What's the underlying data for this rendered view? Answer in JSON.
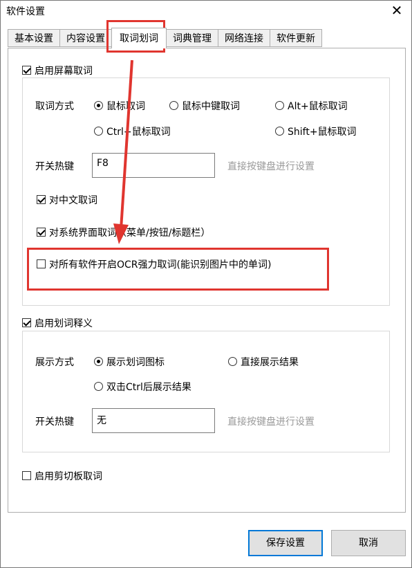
{
  "window": {
    "title": "软件设置",
    "close_glyph": "✕"
  },
  "tabs": [
    {
      "label": "基本设置",
      "active": false
    },
    {
      "label": "内容设置",
      "active": false
    },
    {
      "label": "取词划词",
      "active": true
    },
    {
      "label": "词典管理",
      "active": false
    },
    {
      "label": "网络连接",
      "active": false
    },
    {
      "label": "软件更新",
      "active": false
    }
  ],
  "screen_capture": {
    "enable_label": "启用屏幕取词",
    "enabled": true,
    "method_label": "取词方式",
    "methods": [
      {
        "label": "鼠标取词",
        "selected": true
      },
      {
        "label": "鼠标中键取词",
        "selected": false
      },
      {
        "label": "Alt+鼠标取词",
        "selected": false
      },
      {
        "label": "Ctrl+鼠标取词",
        "selected": false
      },
      {
        "label": "Shift+鼠标取词",
        "selected": false
      }
    ],
    "hotkey_label": "开关热键",
    "hotkey_value": "F8",
    "hotkey_hint": "直接按键盘进行设置",
    "chinese_label": "对中文取词",
    "chinese_checked": true,
    "system_ui_label": "对系统界面取词（菜单/按钮/标题栏）",
    "system_ui_checked": true,
    "ocr_label": "对所有软件开启OCR强力取词(能识别图片中的单词)",
    "ocr_checked": false
  },
  "selection_translate": {
    "enable_label": "启用划词释义",
    "enabled": true,
    "display_label": "展示方式",
    "modes": [
      {
        "label": "展示划词图标",
        "selected": true
      },
      {
        "label": "直接展示结果",
        "selected": false
      },
      {
        "label": "双击Ctrl后展示结果",
        "selected": false
      }
    ],
    "hotkey_label": "开关热键",
    "hotkey_value": "无",
    "hotkey_hint": "直接按键盘进行设置"
  },
  "clipboard": {
    "enable_label": "启用剪切板取词",
    "enabled": false
  },
  "buttons": {
    "save_label": "保存设置",
    "cancel_label": "取消"
  },
  "colors": {
    "highlight": "#e0352f",
    "primary_border": "#0078d7"
  }
}
